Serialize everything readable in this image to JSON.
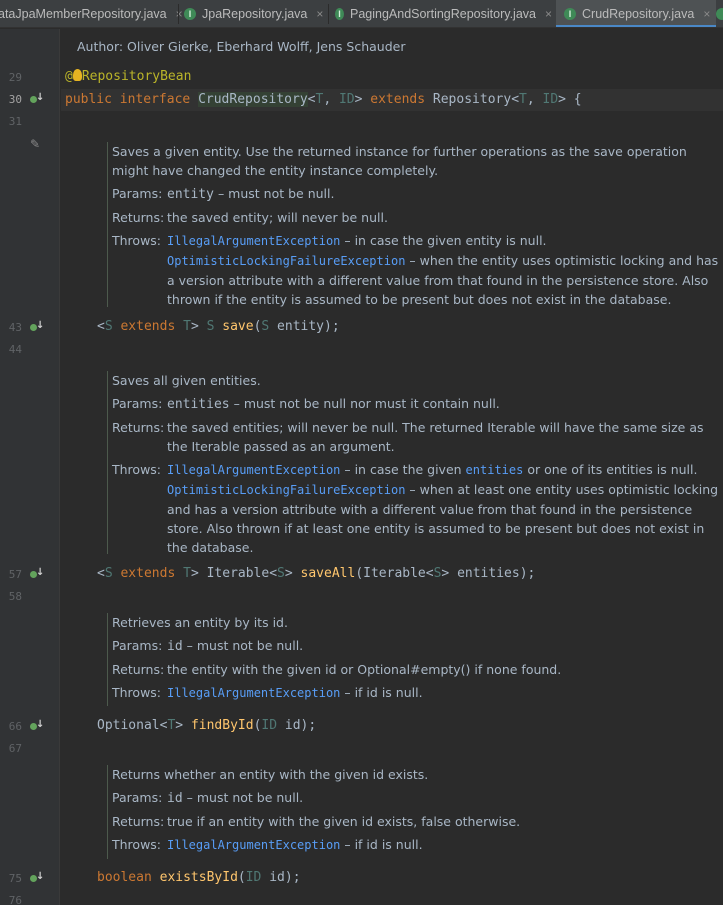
{
  "tabs": [
    {
      "label": "ataJpaMemberRepository.java",
      "close": "×"
    },
    {
      "label": "JpaRepository.java",
      "close": "×"
    },
    {
      "label": "PagingAndSortingRepository.java",
      "close": "×"
    },
    {
      "label": "CrudRepository.java",
      "close": "×"
    }
  ],
  "colors": {
    "accent": "#4a88c7",
    "keyword": "#cc7832",
    "function": "#ffc66d",
    "link": "#589df6",
    "background": "#2b2b2b"
  },
  "gutter": {
    "lines": [
      "29",
      "30",
      "31",
      "43",
      "44",
      "57",
      "58",
      "66",
      "67",
      "75",
      "76"
    ]
  },
  "header": {
    "authors": "Author: Oliver Gierke, Eberhard Wolff, Jens Schauder"
  },
  "code": {
    "annotation_at": "@",
    "annotation_rest": "RepositoryBean",
    "l30_public": "public",
    "l30_interface": "interface",
    "l30_name": "CrudRepository",
    "l30_lt": "<",
    "l30_T": "T",
    "l30_comma": ", ",
    "l30_ID": "ID",
    "l30_gt": ">",
    "l30_extends": "extends",
    "l30_repo": "Repository",
    "l30_lt2": "<",
    "l30_T2": "T",
    "l30_comma2": ", ",
    "l30_ID2": "ID",
    "l30_end": "> {",
    "save_lt": "<",
    "save_S": "S",
    "save_extends": "extends",
    "save_T": "T",
    "save_gt": "> ",
    "save_ret": "S",
    "save_name": "save",
    "save_open": "(",
    "save_pS": "S",
    "save_rest": " entity);",
    "saveall_lt": "<",
    "saveall_S": "S",
    "saveall_extends": "extends",
    "saveall_T": "T",
    "saveall_gt": "> Iterable<",
    "saveall_S2": "S",
    "saveall_gt2": "> ",
    "saveall_name": "saveAll",
    "saveall_args1": "(Iterable<",
    "saveall_S3": "S",
    "saveall_args2": "> entities);",
    "find_ret1": "Optional<",
    "find_T": "T",
    "find_ret2": "> ",
    "find_name": "findById",
    "find_open": "(",
    "find_ID": "ID",
    "find_rest": " id);",
    "exists_kw": "boolean",
    "exists_name": "existsById",
    "exists_open": "(",
    "exists_ID": "ID",
    "exists_rest": " id);"
  },
  "docs": {
    "save": {
      "desc": "Saves a given entity. Use the returned instance for further operations as the save operation might have changed the entity instance completely.",
      "params_label": "Params:",
      "params_name": "entity",
      "params_text": " – must not be null.",
      "returns_label": "Returns:",
      "returns_text": "the saved entity; will never be null.",
      "throws_label": "Throws:",
      "throws1_link": "IllegalArgumentException",
      "throws1_text": " – in case the given entity is null.",
      "throws2_link": "OptimisticLockingFailureException",
      "throws2_text": " – when the entity uses optimistic locking and has a version attribute with a different value from that found in the persistence store. Also thrown if the entity is assumed to be present but does not exist in the database."
    },
    "saveall": {
      "desc": "Saves all given entities.",
      "params_label": "Params:",
      "params_name": "entities",
      "params_text": " – must not be null nor must it contain null.",
      "returns_label": "Returns:",
      "returns_text": "the saved entities; will never be null. The returned Iterable will have the same size as the Iterable passed as an argument.",
      "throws_label": "Throws:",
      "throws1_link": "IllegalArgumentException",
      "throws1_text_a": " – in case the given ",
      "throws1_link2": "entities",
      "throws1_text_b": " or one of its entities is null.",
      "throws2_link": "OptimisticLockingFailureException",
      "throws2_text": " – when at least one entity uses optimistic locking and has a version attribute with a different value from that found in the persistence store. Also thrown if at least one entity is assumed to be present but does not exist in the database."
    },
    "find": {
      "desc": "Retrieves an entity by its id.",
      "params_label": "Params:",
      "params_name": "id",
      "params_text": " – must not be null.",
      "returns_label": "Returns:",
      "returns_text": "the entity with the given id or Optional#empty() if none found.",
      "throws_label": "Throws:",
      "throws1_link": "IllegalArgumentException",
      "throws1_text": " – if id is null."
    },
    "exists": {
      "desc": "Returns whether an entity with the given id exists.",
      "params_label": "Params:",
      "params_name": "id",
      "params_text": " – must not be null.",
      "returns_label": "Returns:",
      "returns_text": "true if an entity with the given id exists, false otherwise.",
      "throws_label": "Throws:",
      "throws1_link": "IllegalArgumentException",
      "throws1_text": " – if id is null."
    }
  }
}
